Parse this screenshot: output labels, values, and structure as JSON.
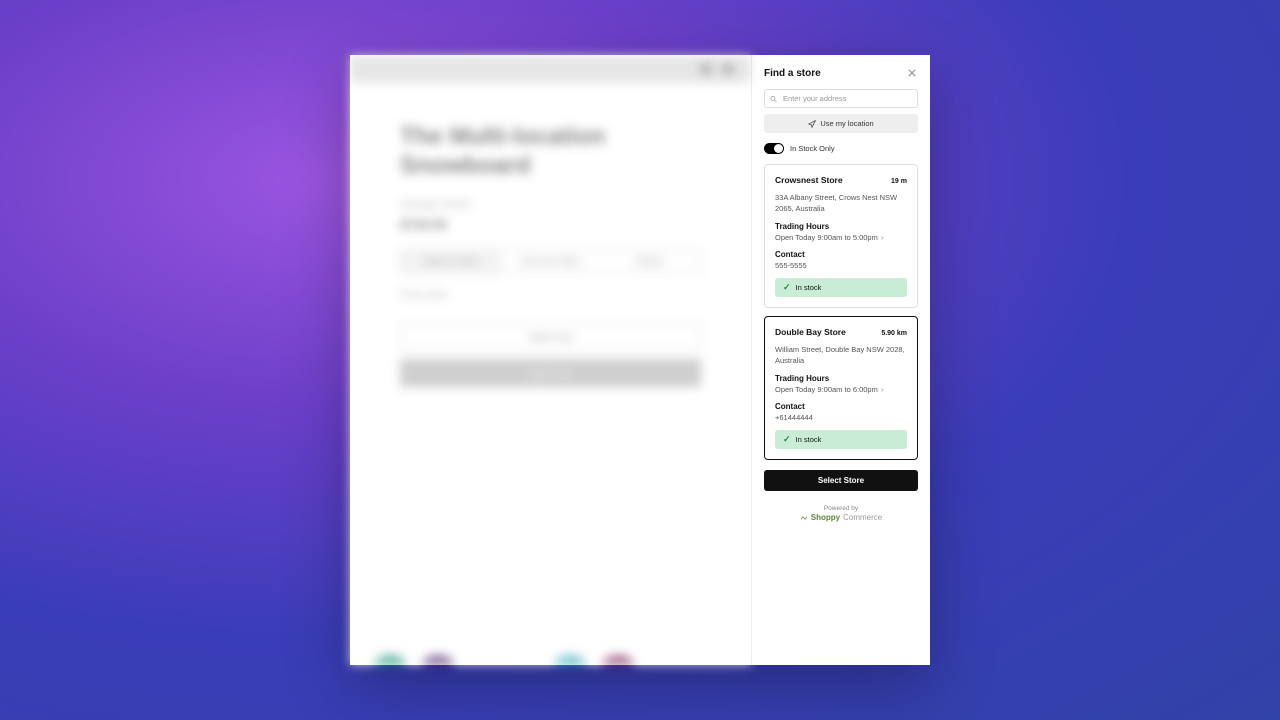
{
  "left": {
    "title": "The Multi-location Snowboard",
    "vendor": "Hydrogen Vendor",
    "price": "$729.95",
    "tabs": [
      "Search in Store",
      "Click and Collect",
      "Delivery"
    ],
    "find": "Find a store",
    "add_to_cart": "Add to cart",
    "buy_now": "Buy it now"
  },
  "panel": {
    "title": "Find a store",
    "search_placeholder": "Enter your address",
    "use_location": "Use my location",
    "in_stock_only": "In Stock Only",
    "select_store": "Select Store",
    "powered_by": "Powered by",
    "brand": "Shoppy",
    "brand_sub": "Commerce"
  },
  "stores": [
    {
      "name": "Crowsnest Store",
      "distance": "19 m",
      "address": "33A Albany Street, Crows Nest NSW 2065, Australia",
      "hours_title": "Trading Hours",
      "hours": "Open Today 9:00am to 5:00pm",
      "contact_title": "Contact",
      "contact": "555-5555",
      "stock": "In stock",
      "selected": false
    },
    {
      "name": "Double Bay Store",
      "distance": "5.90 km",
      "address": "William Street, Double Bay NSW 2028, Australia",
      "hours_title": "Trading Hours",
      "hours": "Open Today 9:00am to 6:00pm",
      "contact_title": "Contact",
      "contact": "+61444444",
      "stock": "In stock",
      "selected": true
    }
  ]
}
